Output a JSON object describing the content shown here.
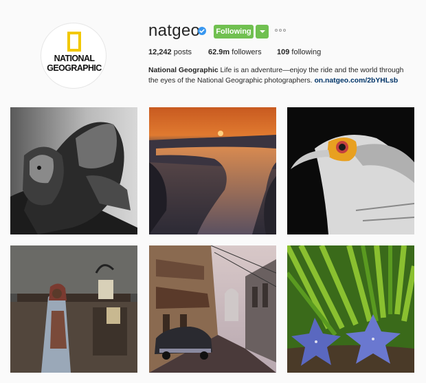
{
  "profile": {
    "avatar_lines": [
      "NATIONAL",
      "GEOGRAPHIC"
    ],
    "username": "natgeo",
    "follow_label": "Following",
    "stats": {
      "posts_count": "12,242",
      "posts_label": "posts",
      "followers_count": "62.9m",
      "followers_label": "followers",
      "following_count": "109",
      "following_label": "following"
    },
    "bio": {
      "name": "National Geographic",
      "text": " Life is an adventure—enjoy the ride and the world through the eyes of the National Geographic photographers. ",
      "link": "on.natgeo.com/2bYHLsb"
    }
  },
  "colors": {
    "follow_green": "#70c050",
    "verified_blue": "#3897f0",
    "link_blue": "#003569",
    "logo_yellow": "#f2c800"
  },
  "icons": {
    "verified": "verified-badge-icon",
    "more": "more-options-icon",
    "dropdown": "chevron-down-icon"
  }
}
